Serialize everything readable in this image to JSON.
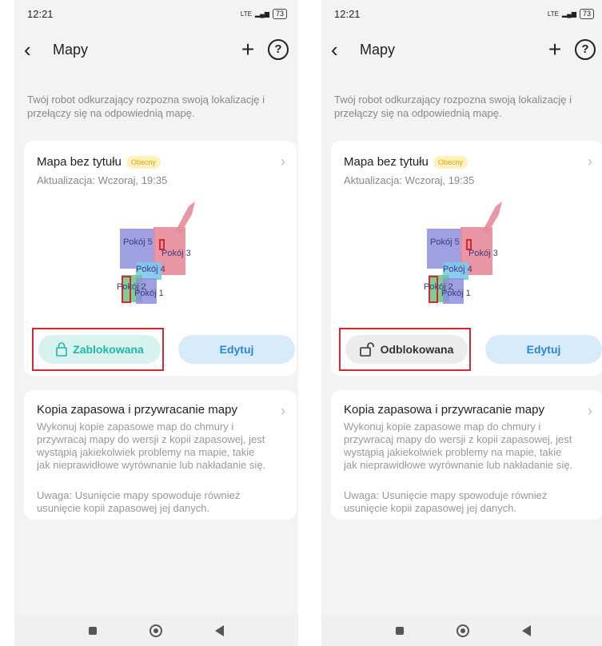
{
  "screens": [
    {
      "status": {
        "time": "12:21",
        "network": "LTE",
        "battery": "73"
      },
      "header": {
        "title": "Mapy"
      },
      "description": "Twój robot odkurzający rozpozna swoją lokalizację i przełączy się na odpowiednią mapę.",
      "map_card": {
        "title": "Mapa bez tytułu",
        "badge": "Obecny",
        "updated": "Aktualizacja: Wczoraj, 19:35",
        "rooms": [
          "Pokój 5",
          "Pokój 3",
          "Pokój 4",
          "Pokój 2",
          "Pokój 1"
        ],
        "lock_button": "Zablokowana",
        "lock_state": "locked",
        "edit_button": "Edytuj"
      },
      "backup_card": {
        "title": "Kopia zapasowa i przywracanie mapy",
        "body": "Wykonuj kopie zapasowe map do chmury i przywracaj mapy do wersji z kopii zapasowej, jest wystąpią jakiekolwiek problemy na mapie, takie jak nieprawidłowe wyrównanie lub nakładanie się.",
        "note": "Uwaga: Usunięcie mapy spowoduje również usunięcie kopii zapasowej jej danych."
      }
    },
    {
      "status": {
        "time": "12:21",
        "network": "LTE",
        "battery": "73"
      },
      "header": {
        "title": "Mapy"
      },
      "description": "Twój robot odkurzający rozpozna swoją lokalizację i przełączy się na odpowiednią mapę.",
      "map_card": {
        "title": "Mapa bez tytułu",
        "badge": "Obecny",
        "updated": "Aktualizacja: Wczoraj, 19:35",
        "rooms": [
          "Pokój 5",
          "Pokój 3",
          "Pokój 4",
          "Pokój 2",
          "Pokój 1"
        ],
        "lock_button": "Odblokowana",
        "lock_state": "unlocked",
        "edit_button": "Edytuj"
      },
      "backup_card": {
        "title": "Kopia zapasowa i przywracanie mapy",
        "body": "Wykonuj kopie zapasowe map do chmury i przywracaj mapy do wersji z kopii zapasowej, jest wystąpią jakiekolwiek problemy na mapie, takie jak nieprawidłowe wyrównanie lub nakładanie się.",
        "note": "Uwaga: Usunięcie mapy spowoduje również usunięcie kopii zapasowej jej danych."
      }
    }
  ],
  "colors": {
    "lock_accent": "#1fb7a8",
    "edit_accent": "#2a86d6",
    "highlight": "#d9262e",
    "badge": "#e0a400"
  }
}
